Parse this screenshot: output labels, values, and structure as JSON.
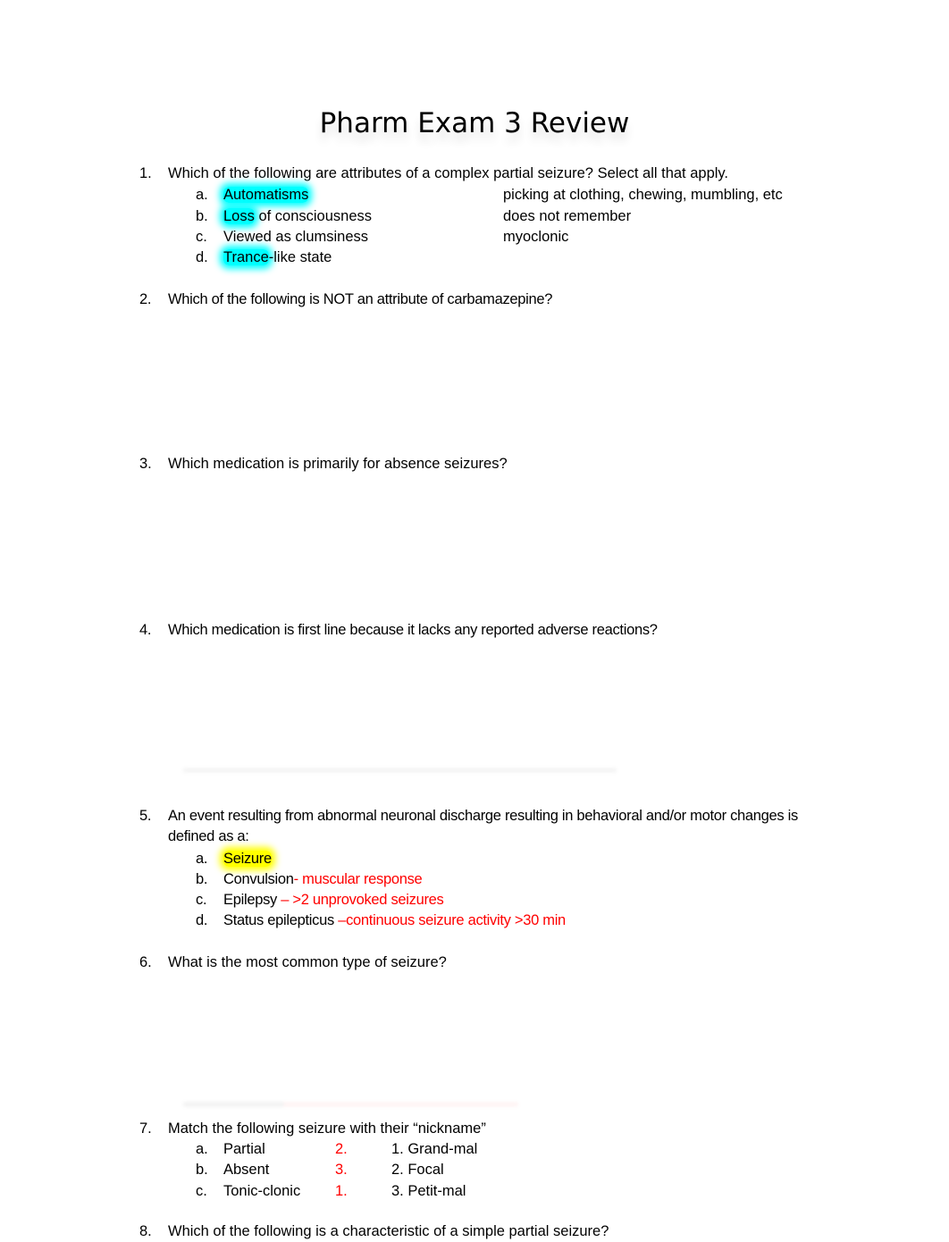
{
  "document": {
    "title": "Pharm Exam 3 Review"
  },
  "questions": [
    {
      "number": "1.",
      "text": "Which of the following are attributes of a complex partial seizure? Select all that apply.",
      "options": [
        {
          "letter": "a.",
          "highlighted": "Automatisms",
          "rest": "",
          "note": "picking at clothing, chewing, mumbling, etc"
        },
        {
          "letter": "b.",
          "highlighted": "Loss",
          "rest": " of consciousness",
          "note": "does not remember"
        },
        {
          "letter": "c.",
          "highlighted": "",
          "rest": "Viewed as clumsiness",
          "note": "myoclonic"
        },
        {
          "letter": "d.",
          "highlighted": "Trance",
          "rest": "-like state",
          "note": ""
        }
      ],
      "highlight_color": "#00ffff"
    },
    {
      "number": "2.",
      "text": "Which of the following is NOT an attribute of carbamazepine?"
    },
    {
      "number": "3.",
      "text": "Which medication is primarily for absence seizures?"
    },
    {
      "number": "4.",
      "text": "Which medication is first line because it lacks any reported adverse reactions?"
    },
    {
      "number": "5.",
      "text": "An event resulting from abnormal neuronal discharge resulting in behavioral and/or motor changes is defined as a:",
      "options": [
        {
          "letter": "a.",
          "label": "Seizure",
          "note": ""
        },
        {
          "letter": "b.",
          "label": "Convulsion",
          "note": "- muscular response"
        },
        {
          "letter": "c.",
          "label": "Epilepsy ",
          "note": "– >2 unprovoked seizures"
        },
        {
          "letter": "d.",
          "label": "Status epilepticus ",
          "note": "–continuous seizure activity >30 min"
        }
      ],
      "highlight_color": "#ffff00",
      "note_color": "#ff0000"
    },
    {
      "number": "6.",
      "text": "What is the most common type of seizure?"
    },
    {
      "number": "7.",
      "text": "Match the following seizure with their “nickname”",
      "options": [
        {
          "letter": "a.",
          "label": "Partial",
          "answer": "2.",
          "nickname": "1. Grand-mal"
        },
        {
          "letter": "b.",
          "label": "Absent",
          "answer": "3.",
          "nickname": "2. Focal"
        },
        {
          "letter": "c.",
          "label": "Tonic-clonic",
          "answer": "1.",
          "nickname": "3. Petit-mal"
        }
      ]
    },
    {
      "number": "8.",
      "text": "Which of the following is a characteristic of a simple partial seizure?"
    }
  ]
}
